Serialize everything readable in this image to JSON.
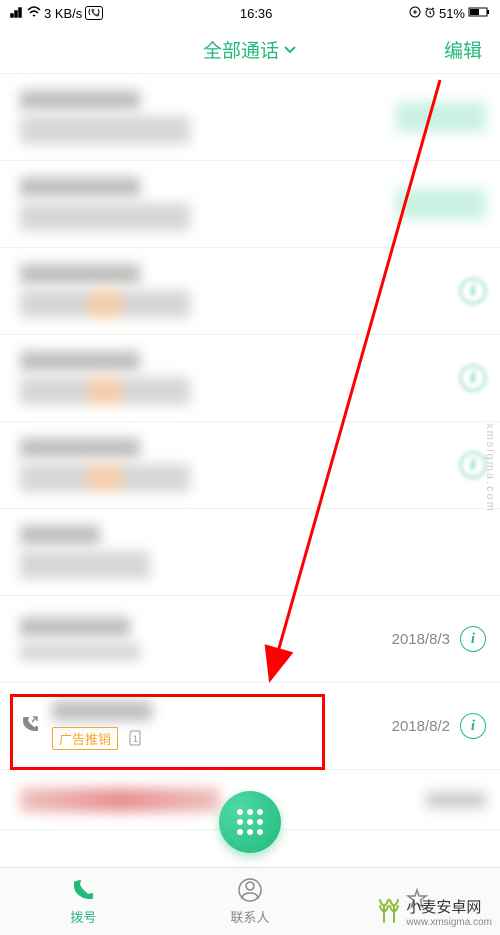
{
  "status": {
    "signal": "⁴⁶",
    "wifi": "≈",
    "speed": "3 KB/s",
    "hd": "HD",
    "time": "16:36",
    "lock": "🔒",
    "alarm": "⏰",
    "battery_pct": "51%"
  },
  "header": {
    "title": "全部通话",
    "edit": "编辑"
  },
  "calls": [
    {
      "date_visible": false,
      "info_visible": false,
      "pixelated": true
    },
    {
      "date_visible": false,
      "info_visible": false,
      "pixelated": true
    },
    {
      "date_visible": false,
      "info_visible": true,
      "info_blur": true,
      "pixelated": true
    },
    {
      "date_visible": false,
      "info_visible": true,
      "info_blur": true,
      "pixelated": true
    },
    {
      "date_visible": false,
      "info_visible": true,
      "info_blur": true,
      "pixelated": true
    },
    {
      "date_visible": false,
      "info_visible": false,
      "pixelated": true
    },
    {
      "date": "2018/8/3",
      "date_visible": true,
      "info_visible": true,
      "pixelated": true
    },
    {
      "date": "2018/8/2",
      "date_visible": true,
      "info_visible": true,
      "pixelated": false,
      "tag": "广告推销",
      "has_call_icon": true
    },
    {
      "date_visible": false,
      "info_visible": false,
      "pixelated": true,
      "red_style": true
    }
  ],
  "fab": {
    "name": "dialpad"
  },
  "nav": {
    "dial": "拨号",
    "contacts": "联系人",
    "fav": ""
  },
  "watermark": {
    "text": "小麦安卓网",
    "url": "www.xmsigma.com"
  },
  "side_watermark": "xmsigma.com",
  "chart_data": null
}
